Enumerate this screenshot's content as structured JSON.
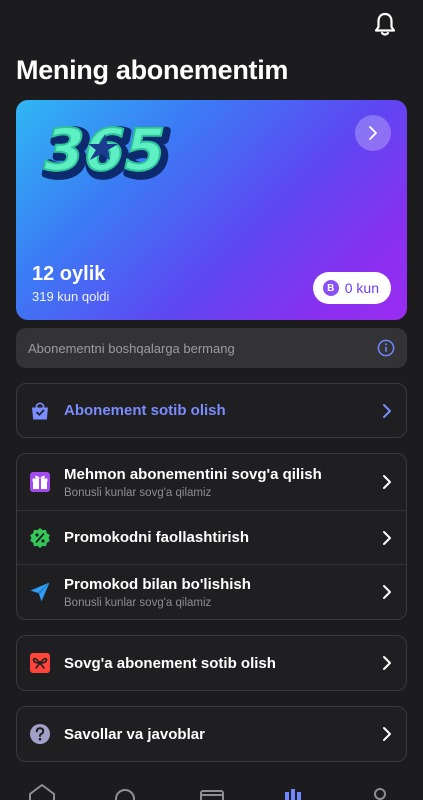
{
  "header": {
    "title": "Mening abonementim"
  },
  "subscription_card": {
    "plan": "12 oylik",
    "remaining": "319 kun qoldi",
    "bonus_days_badge": "B",
    "bonus_days": "0 kun",
    "logo_icon": "365-logo"
  },
  "notice": {
    "text": "Abonementni boshqalarga bermang",
    "icon": "info-icon"
  },
  "groups": {
    "buy": {
      "label": "Abonement sotib olish",
      "accent": "#7b8cff"
    },
    "gift_guest": {
      "label": "Mehmon abonementini sovg'a qilish",
      "hint": "Bonusli kunlar sovg'a qilamiz"
    },
    "promo_activate": {
      "label": "Promokodni faollashtirish"
    },
    "promo_share": {
      "label": "Promokod bilan bo'lishish",
      "hint": "Bonusli kunlar sovg'a qilamiz"
    },
    "gift_buy": {
      "label": "Sovg'a abonement sotib olish"
    },
    "faq": {
      "label": "Savollar va javoblar"
    }
  },
  "colors": {
    "background": "#1c1c1e",
    "card_gradient_start": "#2fb7f3",
    "card_gradient_end": "#9a2cf0",
    "gift_icon": "#a24cf0",
    "promo_icon": "#34c759",
    "share_icon": "#2f9cf5",
    "gift_buy_icon": "#ff453a",
    "faq_icon": "#a1a1c8"
  }
}
